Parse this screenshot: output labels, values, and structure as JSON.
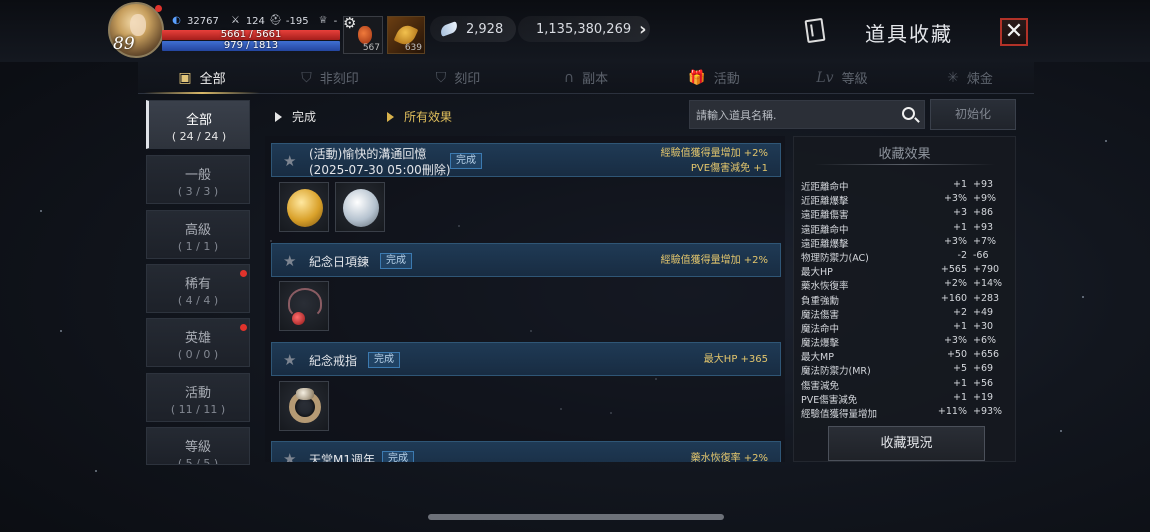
{
  "player": {
    "level": "89",
    "power": "32767",
    "stat2": "124",
    "stat3": "-195",
    "stat4": "-",
    "hp": "5661 / 5661",
    "mp": "979 / 1813"
  },
  "quick_items": [
    {
      "name": "potion-icon",
      "count": "567"
    },
    {
      "name": "scroll-icon",
      "count": "639"
    }
  ],
  "currency": {
    "feathers": "2,928",
    "gold": "1,135,380,269"
  },
  "header": {
    "title": "道具收藏",
    "close": "✕"
  },
  "tabs": [
    {
      "label": "全部",
      "icon": "book-icon",
      "glyph": "▣",
      "active": true
    },
    {
      "label": "非刻印",
      "icon": "shield-icon",
      "glyph": "⛉",
      "active": false
    },
    {
      "label": "刻印",
      "icon": "shield-mark-icon",
      "glyph": "⛉",
      "active": false
    },
    {
      "label": "副本",
      "icon": "gate-icon",
      "glyph": "∩",
      "active": false
    },
    {
      "label": "活動",
      "icon": "gift-icon",
      "glyph": "🎁",
      "active": false
    },
    {
      "label": "等級",
      "icon": "lv-icon",
      "glyph": "Lv",
      "active": false
    },
    {
      "label": "煉金",
      "icon": "alchemy-icon",
      "glyph": "✳",
      "active": false
    }
  ],
  "categories": [
    {
      "name": "全部",
      "count": "( 24 / 24 )",
      "active": true,
      "dot": false
    },
    {
      "name": "一般",
      "count": "( 3 / 3 )",
      "active": false,
      "dot": false
    },
    {
      "name": "高級",
      "count": "( 1 / 1 )",
      "active": false,
      "dot": false
    },
    {
      "name": "稀有",
      "count": "( 4 / 4 )",
      "active": false,
      "dot": true
    },
    {
      "name": "英雄",
      "count": "( 0 / 0 )",
      "active": false,
      "dot": true
    },
    {
      "name": "活動",
      "count": "( 11 / 11 )",
      "active": false,
      "dot": false
    },
    {
      "name": "等級",
      "count": "( 5 / 5 )",
      "active": false,
      "dot": false
    }
  ],
  "filters": {
    "status": "完成",
    "effect": "所有效果"
  },
  "search": {
    "placeholder": "請輸入道具名稱.",
    "reset": "初始化"
  },
  "entries": [
    {
      "name_line1": "(活動)愉快的溝通回憶",
      "name_line2": "(2025-07-30 05:00刪除)",
      "badge": "完成",
      "effects": [
        "經驗值獲得量增加 +2%",
        "PVE傷害減免 +1"
      ],
      "items": [
        "gold-coin-icon",
        "silver-coin-icon"
      ]
    },
    {
      "name_line1": "紀念日項鍊",
      "badge": "完成",
      "effects": [
        "經驗值獲得量增加 +2%"
      ],
      "items": [
        "necklace-icon"
      ]
    },
    {
      "name_line1": "紀念戒指",
      "badge": "完成",
      "effects": [
        "最大HP +365"
      ],
      "items": [
        "ring-icon"
      ]
    },
    {
      "name_line1": "天堂M1週年",
      "badge": "完成",
      "effects": [
        "藥水恢復率 +2%"
      ],
      "items": []
    }
  ],
  "effects_panel": {
    "title": "收藏效果",
    "rows": [
      {
        "name": "近距離命中",
        "a": "+1",
        "b": "+93"
      },
      {
        "name": "近距離爆擊",
        "a": "+3%",
        "b": "+9%"
      },
      {
        "name": "遠距離傷害",
        "a": "+3",
        "b": "+86"
      },
      {
        "name": "遠距離命中",
        "a": "+1",
        "b": "+93"
      },
      {
        "name": "遠距離爆擊",
        "a": "+3%",
        "b": "+7%"
      },
      {
        "name": "物理防禦力(AC)",
        "a": "-2",
        "b": "-66"
      },
      {
        "name": "最大HP",
        "a": "+565",
        "b": "+790"
      },
      {
        "name": "藥水恢復率",
        "a": "+2%",
        "b": "+14%"
      },
      {
        "name": "負重強勳",
        "a": "+160",
        "b": "+283"
      },
      {
        "name": "魔法傷害",
        "a": "+2",
        "b": "+49"
      },
      {
        "name": "魔法命中",
        "a": "+1",
        "b": "+30"
      },
      {
        "name": "魔法爆擊",
        "a": "+3%",
        "b": "+6%"
      },
      {
        "name": "最大MP",
        "a": "+50",
        "b": "+656"
      },
      {
        "name": "魔法防禦力(MR)",
        "a": "+5",
        "b": "+69"
      },
      {
        "name": "傷害減免",
        "a": "+1",
        "b": "+56"
      },
      {
        "name": "PVE傷害減免",
        "a": "+1",
        "b": "+19"
      },
      {
        "name": "經驗值獲得量增加",
        "a": "+11%",
        "b": "+93%"
      }
    ],
    "button": "收藏現況"
  }
}
